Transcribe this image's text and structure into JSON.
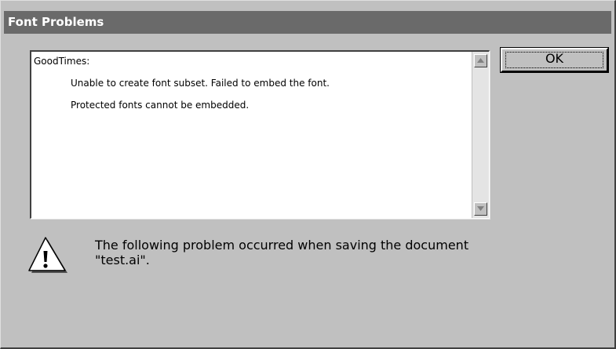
{
  "window": {
    "title": "Font Problems"
  },
  "messages": {
    "font_name": "GoodTimes:",
    "lines": [
      "Unable to create font subset. Failed to embed the font.",
      "Protected fonts cannot be embedded."
    ]
  },
  "buttons": {
    "ok_label": "OK"
  },
  "problem": {
    "line1": "The following problem occurred when saving the document",
    "line2": "\"test.ai\"."
  },
  "icons": {
    "warning": "warning-icon",
    "scroll_up": "scroll-up-arrow-icon",
    "scroll_down": "scroll-down-arrow-icon"
  },
  "colors": {
    "dialog_face": "#c0c0c0",
    "titlebar": "#6a6a6a",
    "title_text": "#ffffff"
  }
}
